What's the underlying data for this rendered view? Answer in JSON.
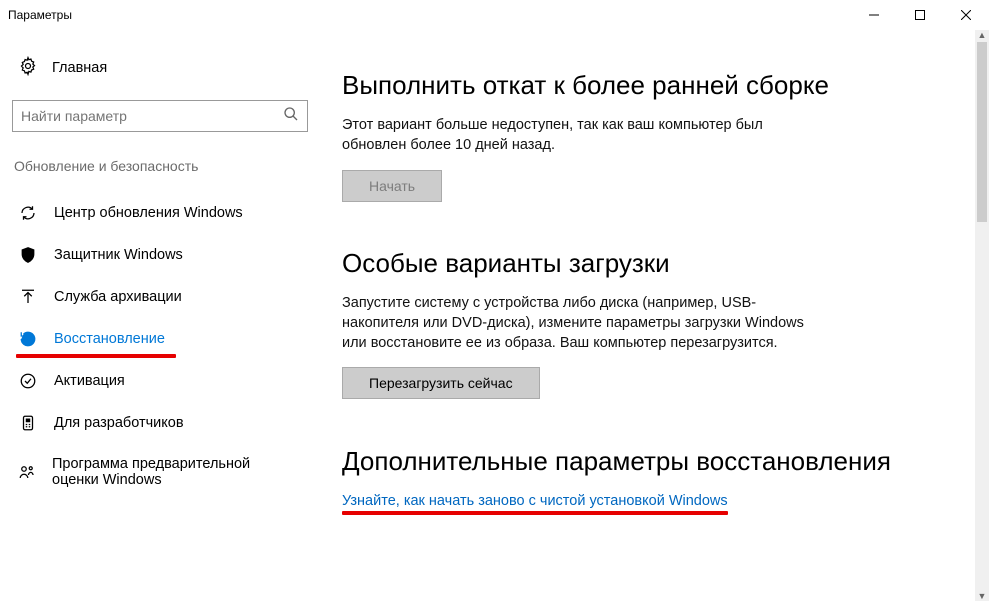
{
  "window": {
    "title": "Параметры"
  },
  "left": {
    "home": "Главная",
    "search_placeholder": "Найти параметр",
    "category": "Обновление и безопасность",
    "items": [
      {
        "label": "Центр обновления Windows",
        "icon": "refresh",
        "active": false
      },
      {
        "label": "Защитник Windows",
        "icon": "shield",
        "active": false
      },
      {
        "label": "Служба архивации",
        "icon": "backup",
        "active": false
      },
      {
        "label": "Восстановление",
        "icon": "history",
        "active": true,
        "highlight": true
      },
      {
        "label": "Активация",
        "icon": "check",
        "active": false
      },
      {
        "label": "Для разработчиков",
        "icon": "dev",
        "active": false
      },
      {
        "label": "Программа предварительной оценки Windows",
        "icon": "insider",
        "active": false
      }
    ]
  },
  "right": {
    "section1": {
      "title": "Выполнить откат к более ранней сборке",
      "desc": "Этот вариант больше недоступен, так как ваш компьютер был обновлен более 10 дней назад.",
      "button": "Начать"
    },
    "section2": {
      "title": "Особые варианты загрузки",
      "desc": "Запустите систему с устройства либо диска (например, USB-накопителя или DVD-диска), измените параметры загрузки Windows или восстановите ее из образа. Ваш компьютер перезагрузится.",
      "button": "Перезагрузить сейчас"
    },
    "section3": {
      "title": "Дополнительные параметры восстановления",
      "link": "Узнайте, как начать заново с чистой установкой Windows"
    }
  }
}
